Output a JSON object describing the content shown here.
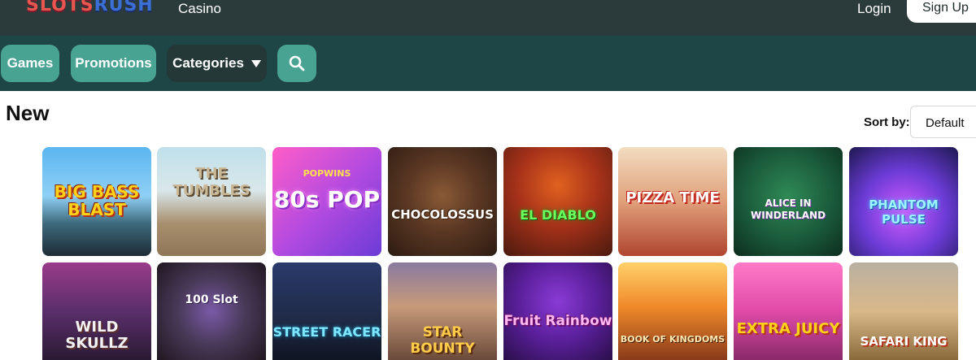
{
  "header": {
    "logo_text_a": "SLOTS",
    "logo_text_b": "RUSH",
    "nav_casino": "Casino",
    "login": "Login",
    "signup": "Sign Up"
  },
  "subnav": {
    "games": "Games",
    "promotions": "Promotions",
    "categories": "Categories"
  },
  "section": {
    "title": "New",
    "sort_label": "Sort by:",
    "sort_value": "Default"
  },
  "games_row1": [
    {
      "title": "BIG BASS BLAST"
    },
    {
      "title": "THE TUMBLES"
    },
    {
      "title": "80s POP",
      "brand": "POPWINS"
    },
    {
      "title": "CHOCOLOSSUS"
    },
    {
      "title": "EL DIABLO"
    },
    {
      "title": "PIZZA TIME"
    },
    {
      "title": "ALICE IN WINDERLAND"
    },
    {
      "title": "PHANTOM PULSE"
    }
  ],
  "games_row2": [
    {
      "title": "WILD SKULLZ"
    },
    {
      "title": "100 Slot"
    },
    {
      "title": "STREET RACER"
    },
    {
      "title": "STAR BOUNTY"
    },
    {
      "title": "Fruit Rainbow"
    },
    {
      "title": "BOOK OF KINGDOMS"
    },
    {
      "title": "EXTRA JUICY"
    },
    {
      "title": "SAFARI KING"
    }
  ]
}
